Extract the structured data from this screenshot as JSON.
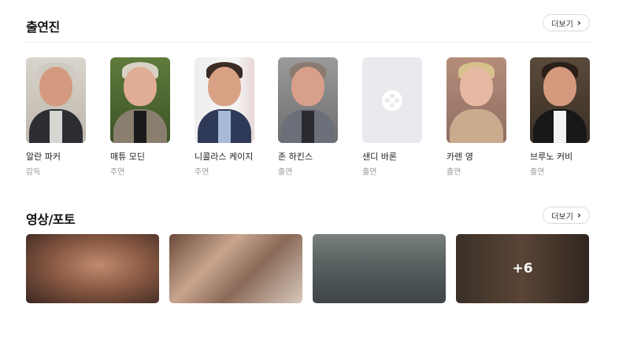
{
  "cast_section": {
    "title": "출연진",
    "more_label": "더보기",
    "items": [
      {
        "name": "알란 파커",
        "role": "감독"
      },
      {
        "name": "매튜 모딘",
        "role": "주연"
      },
      {
        "name": "니콜라스 케이지",
        "role": "주연"
      },
      {
        "name": "존 하킨스",
        "role": "출연"
      },
      {
        "name": "샌디 바론",
        "role": "출연"
      },
      {
        "name": "카렌 영",
        "role": "출연"
      },
      {
        "name": "브루노 커비",
        "role": "출연"
      }
    ]
  },
  "media_section": {
    "title": "영상/포토",
    "more_label": "더보기",
    "more_count": "+6"
  },
  "colors": {
    "placeholder_bg": "#e8eaee",
    "border": "#d9d9d9",
    "role_text": "#999999"
  }
}
